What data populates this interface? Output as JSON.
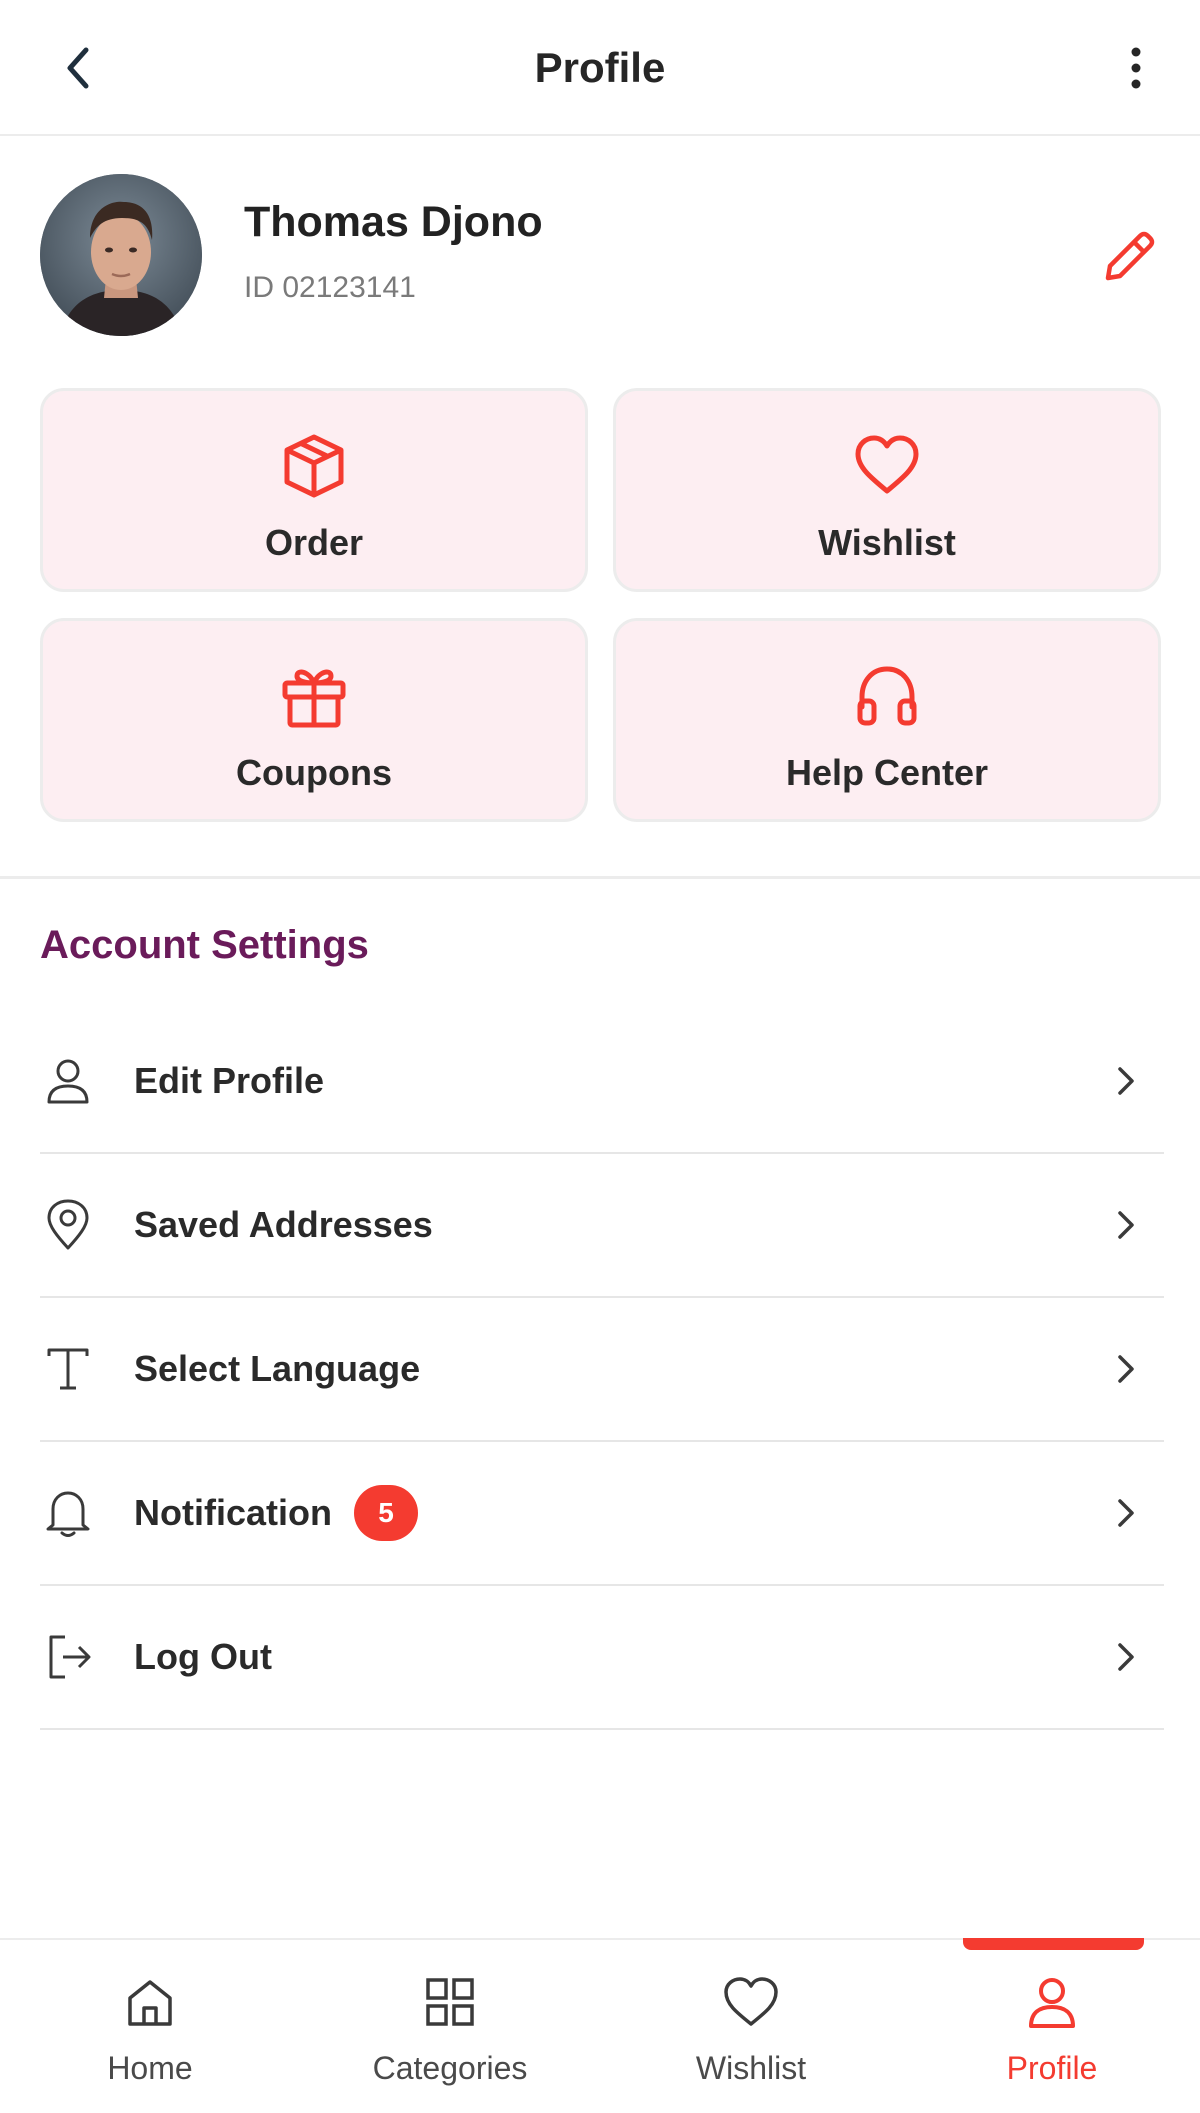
{
  "header": {
    "title": "Profile",
    "back_icon": "chevron-left-icon",
    "more_icon": "vertical-dots-icon"
  },
  "user": {
    "name": "Thomas Djono",
    "id_text": "ID 02123141",
    "edit_icon": "pencil-icon"
  },
  "tiles": [
    {
      "label": "Order",
      "icon": "box-icon"
    },
    {
      "label": "Wishlist",
      "icon": "heart-icon"
    },
    {
      "label": "Coupons",
      "icon": "gift-icon"
    },
    {
      "label": "Help Center",
      "icon": "headphones-icon"
    }
  ],
  "account_settings": {
    "title": "Account Settings",
    "items": [
      {
        "label": "Edit Profile",
        "icon": "user-icon"
      },
      {
        "label": "Saved Addresses",
        "icon": "location-pin-icon"
      },
      {
        "label": "Select Language",
        "icon": "text-icon"
      },
      {
        "label": "Notification",
        "icon": "bell-icon",
        "badge": "5"
      },
      {
        "label": "Log Out",
        "icon": "logout-icon"
      }
    ]
  },
  "bottom_nav": {
    "items": [
      {
        "label": "Home",
        "icon": "home-icon"
      },
      {
        "label": "Categories",
        "icon": "grid-icon"
      },
      {
        "label": "Wishlist",
        "icon": "heart-icon"
      },
      {
        "label": "Profile",
        "icon": "user-icon"
      }
    ],
    "active": "Profile"
  },
  "colors": {
    "accent": "#f43b30",
    "tile_bg": "#fdeef2",
    "section_title": "#6a1b5a",
    "text": "#2a2a2a"
  }
}
